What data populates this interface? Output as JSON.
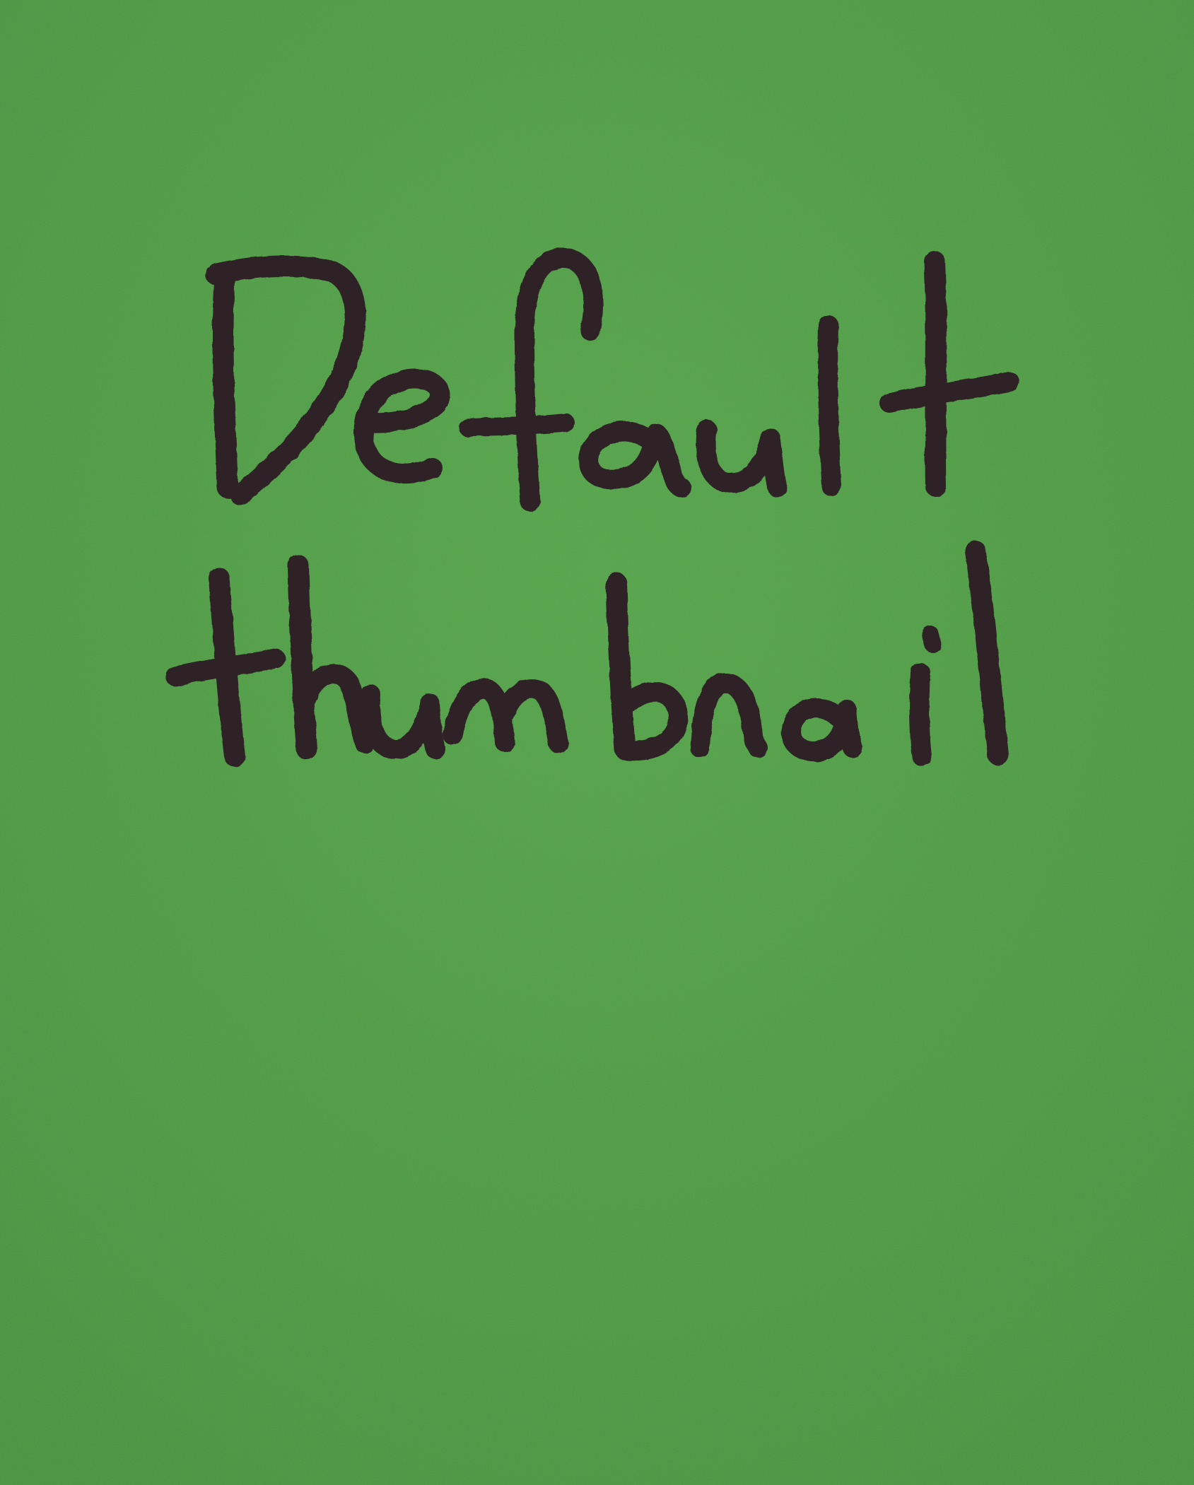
{
  "image": {
    "handwritten_text": {
      "line_1": "Default",
      "line_2": "thumbnail"
    },
    "colors": {
      "paper_light": "#56a84a",
      "paper_base": "#4f9f43",
      "paper_dark": "#3f8a37",
      "ink": "#2e2326"
    }
  }
}
